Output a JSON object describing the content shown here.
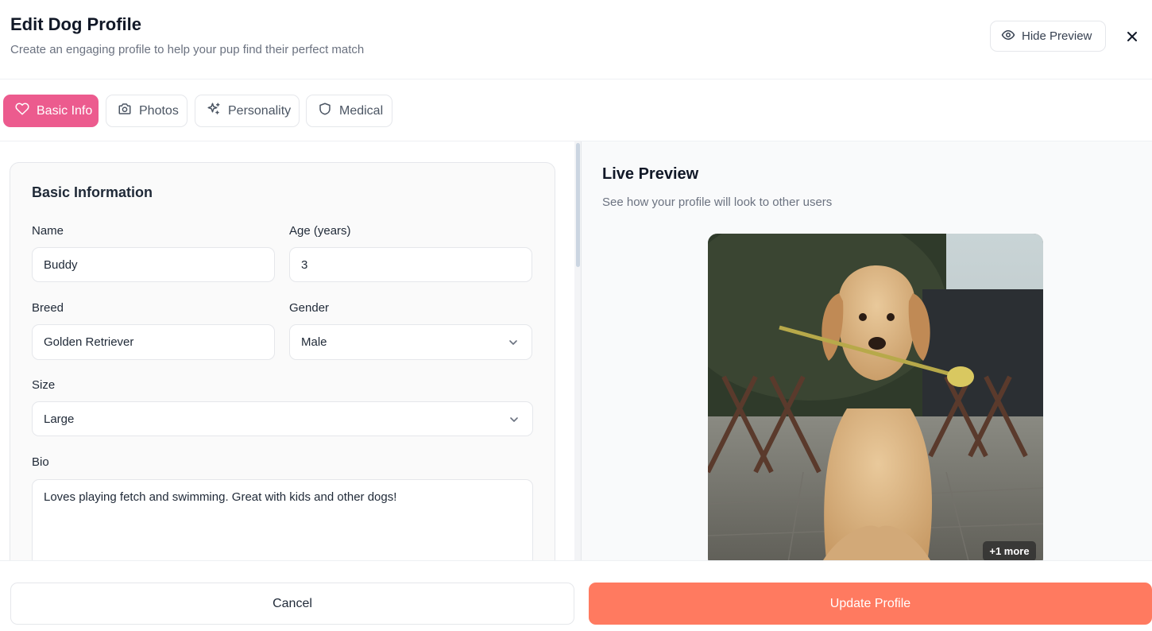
{
  "header": {
    "title": "Edit Dog Profile",
    "subtitle": "Create an engaging profile to help your pup find their perfect match",
    "hide_preview_label": "Hide Preview",
    "close_icon": "close-icon"
  },
  "tabs": [
    {
      "label": "Basic Info",
      "icon": "heart-icon",
      "active": true
    },
    {
      "label": "Photos",
      "icon": "camera-icon",
      "active": false
    },
    {
      "label": "Personality",
      "icon": "sparkles-icon",
      "active": false
    },
    {
      "label": "Medical",
      "icon": "shield-icon",
      "active": false
    }
  ],
  "form": {
    "section_title": "Basic Information",
    "name": {
      "label": "Name",
      "value": "Buddy"
    },
    "age": {
      "label": "Age (years)",
      "value": "3"
    },
    "breed": {
      "label": "Breed",
      "value": "Golden Retriever"
    },
    "gender": {
      "label": "Gender",
      "value": "Male"
    },
    "size": {
      "label": "Size",
      "value": "Large"
    },
    "bio": {
      "label": "Bio",
      "value": "Loves playing fetch and swimming. Great with kids and other dogs!"
    }
  },
  "preview": {
    "title": "Live Preview",
    "subtitle": "See how your profile will look to other users",
    "more_photos_badge": "+1 more"
  },
  "footer": {
    "cancel_label": "Cancel",
    "update_label": "Update Profile"
  },
  "colors": {
    "active_tab": "#ec5b8e",
    "primary_button": "#ff7a60"
  }
}
